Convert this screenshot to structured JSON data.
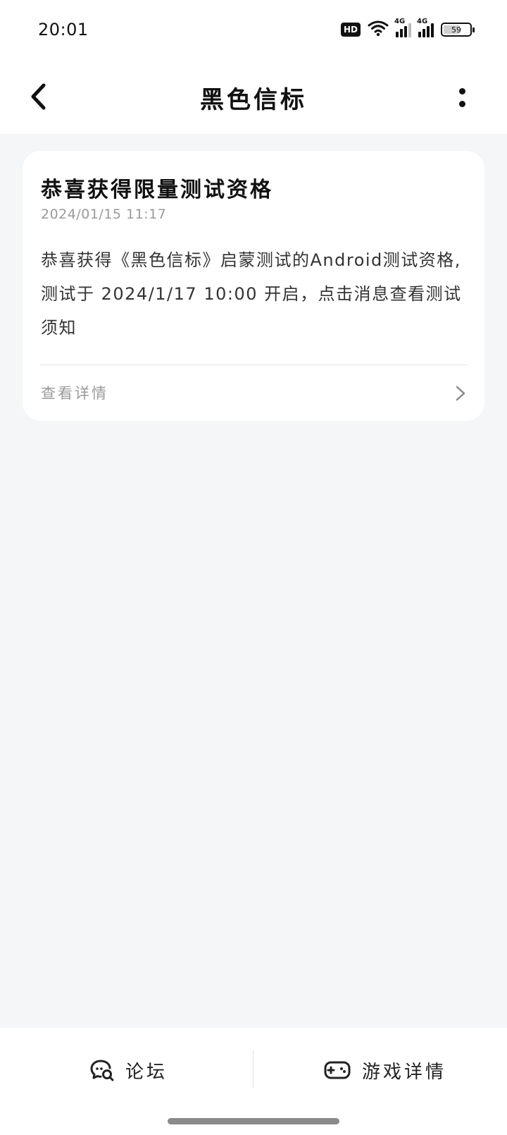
{
  "status_bar": {
    "time": "20:01",
    "hd_label": "HD",
    "network_labels": [
      "4G",
      "4G"
    ],
    "battery_level": "59",
    "icons": [
      "hd-voice-icon",
      "wifi-icon",
      "signal-icon",
      "signal-icon",
      "battery-icon"
    ]
  },
  "header": {
    "title": "黑色信标",
    "back_icon": "chevron-left-icon",
    "more_icon": "more-vertical-icon"
  },
  "message": {
    "title": "恭喜获得限量测试资格",
    "date": "2024/01/15 11:17",
    "body": "恭喜获得《黑色信标》启蒙测试的Android测试资格,测试于 2024/1/17 10:00 开启，点击消息查看测试须知",
    "link_label": "查看详情",
    "link_icon": "chevron-right-icon"
  },
  "bottom_bar": {
    "forum_label": "论坛",
    "forum_icon": "forum-chat-icon",
    "game_label": "游戏详情",
    "game_icon": "gamepad-icon"
  },
  "colors": {
    "page_background": "#f5f6f8",
    "card_background": "#ffffff",
    "title_text": "#111111",
    "muted_text": "#9a9a9a"
  }
}
